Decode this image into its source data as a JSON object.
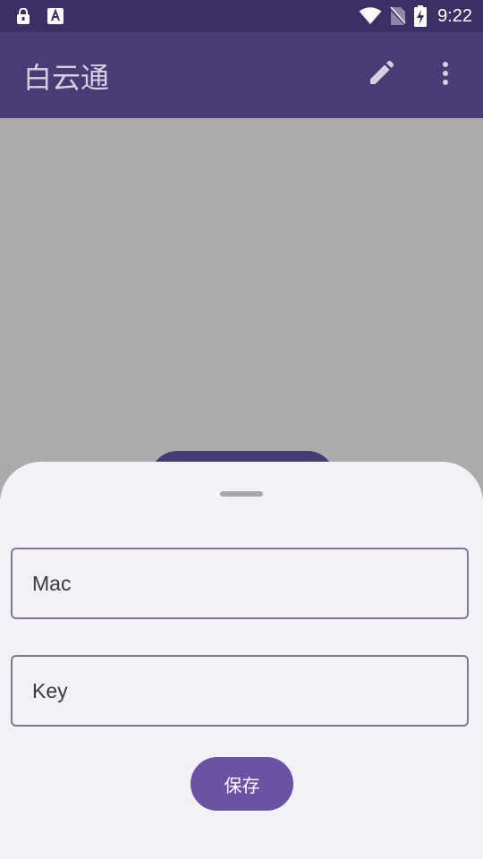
{
  "status_bar": {
    "time": "9:22",
    "left_icons": [
      "lock-icon",
      "font-a-icon"
    ],
    "right_icons": [
      "wifi-icon",
      "no-sim-icon",
      "battery-charging-icon"
    ]
  },
  "app_bar": {
    "title": "白云通",
    "actions": [
      "edit-icon",
      "more-vert-icon"
    ],
    "color": "#4a3b75"
  },
  "sheet": {
    "mac_field": {
      "value": "",
      "placeholder": "Mac"
    },
    "key_field": {
      "value": "",
      "placeholder": "Key"
    },
    "save_label": "保存",
    "accent": "#6a52a4"
  }
}
